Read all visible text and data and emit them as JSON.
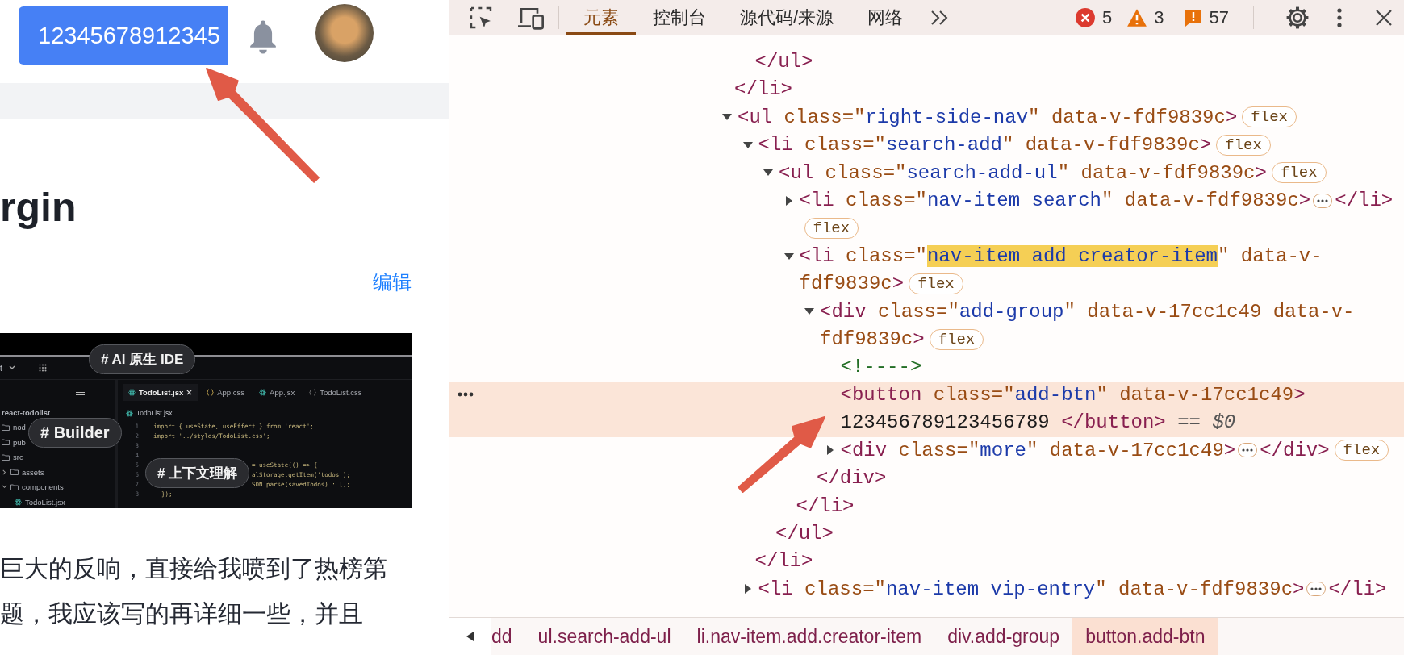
{
  "blog": {
    "create_button": "12345678912345",
    "heading": "rgin",
    "edit_link": "编辑",
    "article_image": {
      "top_bar": "t",
      "tags": [
        {
          "kind": "ai",
          "label": "# AI 原生 IDE"
        },
        {
          "kind": "builder",
          "label": "# Builder"
        },
        {
          "kind": "context",
          "label": "# 上下文理解"
        }
      ],
      "explorer": [
        {
          "label": "react-todolist",
          "kind": "root",
          "children": [
            {
              "label": "nod",
              "kind": "folder"
            },
            {
              "label": "pub",
              "kind": "folder"
            },
            {
              "label": "src",
              "kind": "folder"
            },
            {
              "label": "assets",
              "kind": "folder",
              "expanded": false
            },
            {
              "label": "components",
              "kind": "folder",
              "expanded": true,
              "children": [
                {
                  "label": "TodoList.jsx",
                  "kind": "react"
                }
              ]
            }
          ]
        }
      ],
      "tabs": [
        {
          "label": "TodoList.jsx",
          "kind": "react",
          "selected": true
        },
        {
          "label": "App.css",
          "kind": "css",
          "selected": false
        },
        {
          "label": "App.jsx",
          "kind": "react",
          "selected": false
        },
        {
          "label": "TodoList.css",
          "kind": "css",
          "selected": false
        }
      ],
      "breadcrumb": "TodoList.jsx",
      "code": [
        {
          "number": "1",
          "kind": "line",
          "text": "import { useState, useEffect } from 'react';"
        },
        {
          "number": "2",
          "kind": "line",
          "text": "import '../styles/TodoList.css';"
        },
        {
          "number": "3",
          "kind": "line"
        },
        {
          "number": "4",
          "kind": "line"
        },
        {
          "number": "5",
          "kind": "after_tag",
          "text": "= useState(() => {"
        },
        {
          "number": "6",
          "kind": "after_tag",
          "text": "alStorage.getItem('todos');"
        },
        {
          "number": "7",
          "kind": "after_tag",
          "text": "SON.parse(savedTodos) : [];"
        },
        {
          "number": "8",
          "kind": "indented",
          "text": "});"
        }
      ]
    },
    "paragraph": [
      "巨大的反响，直接给我喷到了热榜第",
      "题，我应该写的再详细一些，并且"
    ]
  },
  "devtools": {
    "toolbar": {
      "tabs": [
        {
          "label": "元素",
          "selected": true
        },
        {
          "label": "控制台",
          "selected": false
        },
        {
          "label": "源代码/来源",
          "selected": false
        },
        {
          "label": "网络",
          "selected": false
        }
      ],
      "errors": "5",
      "warnings": "3",
      "issues": "57"
    },
    "elements_tree": [
      {
        "kind": "tail",
        "children": [
          {
            "kind": "close",
            "text": "</ul>"
          }
        ],
        "close": "</li>"
      },
      {
        "kind": "element",
        "selected": false,
        "expanded": true,
        "badge": "flex",
        "open": [
          [
            {
              "kind": "tag",
              "text": "<ul"
            },
            {
              "kind": "attr",
              "text": " class=\""
            },
            {
              "kind": "value",
              "text": "right-side-nav"
            },
            {
              "kind": "attr",
              "text": "\" data-v-fdf9839c"
            },
            {
              "kind": "tag",
              "text": ">"
            }
          ]
        ],
        "children": [
          {
            "kind": "element",
            "selected": false,
            "expanded": true,
            "badge": "flex",
            "open": [
              [
                {
                  "kind": "tag",
                  "text": "<li"
                },
                {
                  "kind": "attr",
                  "text": " class=\""
                },
                {
                  "kind": "value",
                  "text": "search-add"
                },
                {
                  "kind": "attr",
                  "text": "\" data-v-fdf9839c"
                },
                {
                  "kind": "tag",
                  "text": ">"
                }
              ]
            ],
            "close": "</li>",
            "children": [
              {
                "kind": "element",
                "selected": false,
                "expanded": true,
                "badge": "flex",
                "open": [
                  [
                    {
                      "kind": "tag",
                      "text": "<ul"
                    },
                    {
                      "kind": "attr",
                      "text": " class=\""
                    },
                    {
                      "kind": "value",
                      "text": "search-add-ul"
                    },
                    {
                      "kind": "attr",
                      "text": "\" data-v-fdf9839c"
                    },
                    {
                      "kind": "tag",
                      "text": ">"
                    }
                  ]
                ],
                "close": "</ul>",
                "children": [
                  {
                    "kind": "element",
                    "selected": false,
                    "expanded": false,
                    "badge": "flex",
                    "open": [
                      [
                        {
                          "kind": "tag",
                          "text": "<li"
                        },
                        {
                          "kind": "attr",
                          "text": " class=\""
                        },
                        {
                          "kind": "value",
                          "text": "nav-item search"
                        },
                        {
                          "kind": "attr",
                          "text": "\" data-v-fdf9839c"
                        },
                        {
                          "kind": "tag",
                          "text": ">"
                        }
                      ]
                    ],
                    "close": "</li>"
                  },
                  {
                    "kind": "element",
                    "selected": false,
                    "expanded": true,
                    "badge": "flex",
                    "open": [
                      [
                        {
                          "kind": "tag",
                          "text": "<li"
                        },
                        {
                          "kind": "attr",
                          "text": " class=\""
                        },
                        {
                          "kind": "value",
                          "text": "nav-item add creator-item",
                          "highlighted": true
                        },
                        {
                          "kind": "attr",
                          "text": "\" data-v-"
                        }
                      ],
                      [
                        {
                          "kind": "attr",
                          "text": "fdf9839c"
                        },
                        {
                          "kind": "tag",
                          "text": ">"
                        }
                      ]
                    ],
                    "close": "</li>",
                    "children": [
                      {
                        "kind": "element",
                        "selected": false,
                        "expanded": true,
                        "badge": "flex",
                        "open": [
                          [
                            {
                              "kind": "tag",
                              "text": "<div"
                            },
                            {
                              "kind": "attr",
                              "text": " class=\""
                            },
                            {
                              "kind": "value",
                              "text": "add-group"
                            },
                            {
                              "kind": "attr",
                              "text": "\" data-v-17cc1c49 data-v-"
                            }
                          ],
                          [
                            {
                              "kind": "attr",
                              "text": "fdf9839c"
                            },
                            {
                              "kind": "tag",
                              "text": ">"
                            }
                          ]
                        ],
                        "close": "</div>",
                        "children": [
                          {
                            "kind": "comment",
                            "text": "<!---->"
                          },
                          {
                            "kind": "element",
                            "selected": true,
                            "open": [
                              [
                                {
                                  "kind": "tag",
                                  "text": "<button"
                                },
                                {
                                  "kind": "attr",
                                  "text": " class=\""
                                },
                                {
                                  "kind": "value",
                                  "text": "add-btn"
                                },
                                {
                                  "kind": "attr",
                                  "text": "\" data-v-17cc1c49"
                                },
                                {
                                  "kind": "tag",
                                  "text": ">"
                                }
                              ]
                            ],
                            "content": "123456789123456789",
                            "close": "</button>",
                            "console_ref": "== *$0*"
                          },
                          {
                            "kind": "element",
                            "selected": false,
                            "expanded": false,
                            "badge": "flex",
                            "open": [
                              [
                                {
                                  "kind": "tag",
                                  "text": "<div"
                                },
                                {
                                  "kind": "attr",
                                  "text": " class=\""
                                },
                                {
                                  "kind": "value",
                                  "text": "more"
                                },
                                {
                                  "kind": "attr",
                                  "text": "\" data-v-17cc1c49"
                                },
                                {
                                  "kind": "tag",
                                  "text": ">"
                                }
                              ]
                            ],
                            "close": "</div>"
                          }
                        ]
                      }
                    ]
                  }
                ]
              }
            ]
          },
          {
            "kind": "element",
            "selected": false,
            "expanded": false,
            "open": [
              [
                {
                  "kind": "tag",
                  "text": "<li"
                },
                {
                  "kind": "attr",
                  "text": " class=\""
                },
                {
                  "kind": "value",
                  "text": "nav-item vip-entry"
                },
                {
                  "kind": "attr",
                  "text": "\" data-v-fdf9839c"
                },
                {
                  "kind": "tag",
                  "text": ">"
                }
              ]
            ],
            "close": "</li>"
          }
        ]
      }
    ],
    "breadcrumbs": [
      {
        "label": "dd",
        "selected": false
      },
      {
        "label": "ul.search-add-ul",
        "selected": false
      },
      {
        "label": "li.nav-item.add.creator-item",
        "selected": false
      },
      {
        "label": "div.add-group",
        "selected": false
      },
      {
        "label": "button.add-btn",
        "selected": true
      }
    ]
  }
}
